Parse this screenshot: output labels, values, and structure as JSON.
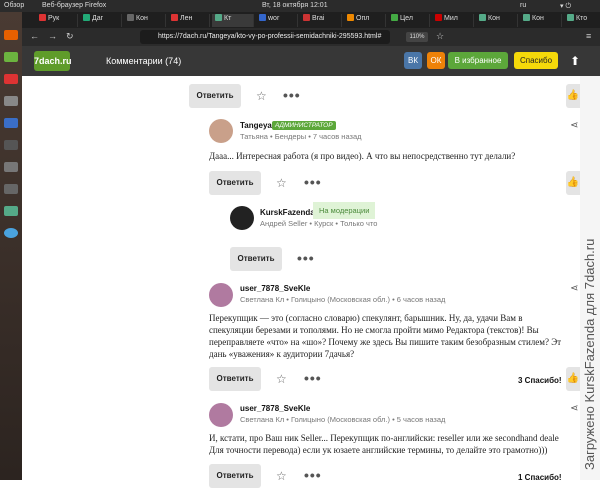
{
  "os_bar": {
    "overview": "Обзор",
    "browser": "Веб-браузер Firefox",
    "datetime": "Вт, 18 октября  12:01",
    "lang": "ru"
  },
  "tabs": [
    "Рук",
    "Даг",
    "Кон",
    "Лен",
    "Кт",
    "wor",
    "Brai",
    "Опл",
    "Цел",
    "Мил",
    "Кон",
    "Кон",
    "Кто"
  ],
  "url": "https://7dach.ru/Tangeya/kto-vy-po-professii-semidachniki-295593.html#",
  "zoom": "110%",
  "site": {
    "logo": "7dach.ru",
    "comments_title": "Комментарии (74)",
    "vk": "ВК",
    "ok": "ОК",
    "favorites": "В избранное",
    "thanks": "Спасибо"
  },
  "reply_label": "Ответить",
  "dots": "•••",
  "comments": [
    {
      "user": "Tangeya",
      "badge": "АДМИНИСТРАТОР",
      "meta": "Татьяна • Бендеры • 7 часов назад",
      "lines": [
        "Дааа... Интересная работа (я про видео). А что вы непосредственно тут делали?"
      ]
    },
    {
      "user": "KurskFazenda",
      "badge": "На модерации",
      "meta": "Андрей Seller • Курск • Только что",
      "lines": []
    },
    {
      "user": "user_7878_SveKle",
      "meta": "Светлана Кл • Голицыно (Московская обл.) • 6 часов назад",
      "lines": [
        "Перекупщик — это (согласно словарю) спекулянт, барышник. Ну, да, удачи Вам в",
        "спекуляции березами и тополями. Но не смогла пройти мимо Редактора (текстов)! Вы",
        "переправляете «что» на «шо»? Почему же здесь Вы пишите таким безобразным стилем? Эт",
        "дань «уважения» к аудитории 7дачья?"
      ],
      "thanks": "3 Спасибо!"
    },
    {
      "user": "user_7878_SveKle",
      "meta": "Светлана Кл • Голицыно (Московская обл.) • 5 часов назад",
      "lines": [
        "И, кстати, про Ваш ник Seller... Перекупщик по-английски: reseller или же secondhand deale",
        "Для точности перевода) если ук юзаете английские термины, то делайте это грамотно)))"
      ],
      "thanks": "1 Спасибо!"
    }
  ],
  "watermark": "Загружено KurskFazenda для 7dach.ru"
}
